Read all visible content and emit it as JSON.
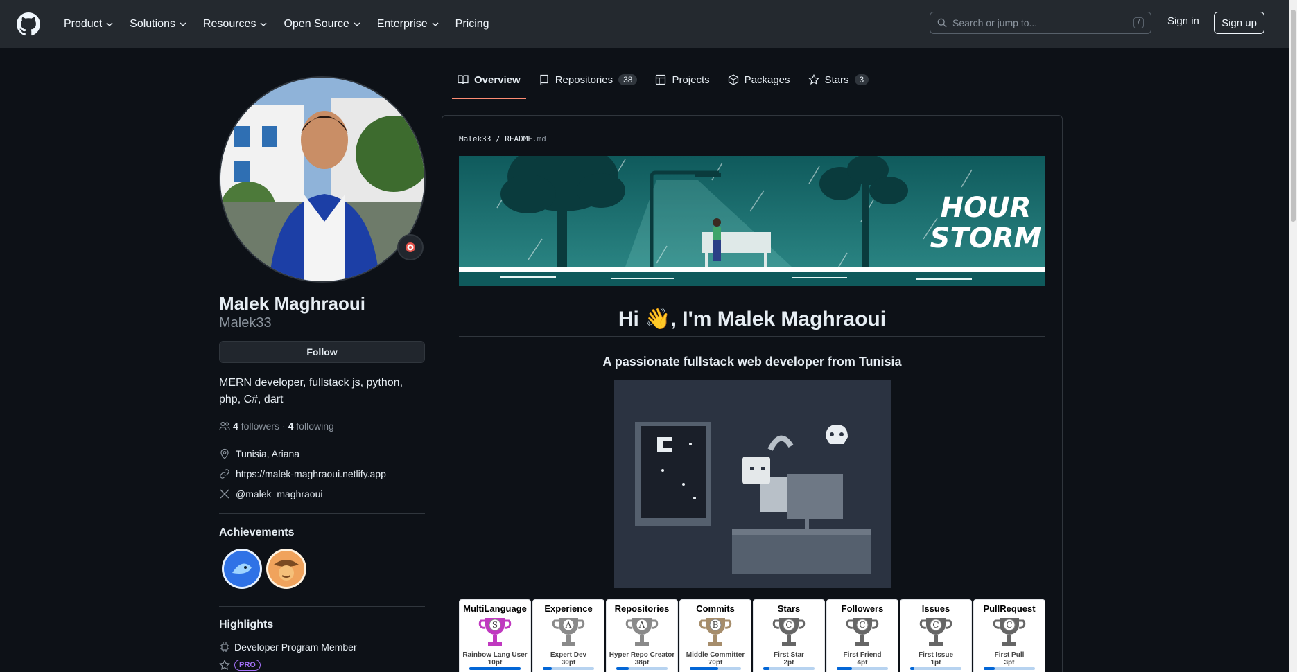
{
  "header": {
    "nav": [
      {
        "label": "Product",
        "has_menu": true
      },
      {
        "label": "Solutions",
        "has_menu": true
      },
      {
        "label": "Resources",
        "has_menu": true
      },
      {
        "label": "Open Source",
        "has_menu": true
      },
      {
        "label": "Enterprise",
        "has_menu": true
      },
      {
        "label": "Pricing",
        "has_menu": false
      }
    ],
    "search_placeholder": "Search or jump to...",
    "search_shortcut": "/",
    "sign_in": "Sign in",
    "sign_up": "Sign up"
  },
  "tabs": [
    {
      "label": "Overview",
      "icon": "book-icon",
      "active": true
    },
    {
      "label": "Repositories",
      "icon": "repo-icon",
      "count": "38"
    },
    {
      "label": "Projects",
      "icon": "table-icon"
    },
    {
      "label": "Packages",
      "icon": "package-icon"
    },
    {
      "label": "Stars",
      "icon": "star-icon",
      "count": "3"
    }
  ],
  "profile": {
    "full_name": "Malek Maghraoui",
    "username": "Malek33",
    "follow_label": "Follow",
    "bio": "MERN developer, fullstack js, python, php, C#, dart",
    "followers_count": "4",
    "followers_label": "followers",
    "separator": "·",
    "following_count": "4",
    "following_label": "following",
    "location": "Tunisia, Ariana",
    "website": "https://malek-maghraoui.netlify.app",
    "twitter": "@malek_maghraoui",
    "achievements_heading": "Achievements",
    "highlights_heading": "Highlights",
    "highlight_item": "Developer Program Member",
    "pro_badge": "PRO"
  },
  "readme": {
    "owner": "Malek33",
    "path_sep": "/",
    "file": "README",
    "file_ext": ".md",
    "banner_text_line1": "HOUR",
    "banner_text_line2": "STORM",
    "heading": "Hi 👋, I'm Malek Maghraoui",
    "tagline": "A passionate fullstack web developer from Tunisia",
    "trophies": [
      {
        "title": "MultiLanguage",
        "rank": "S",
        "name": "Rainbow Lang User",
        "points": "10pt",
        "progress": 1.0,
        "color": "#c039c0"
      },
      {
        "title": "Experience",
        "rank": "A",
        "name": "Expert Dev",
        "points": "30pt",
        "progress": 0.18,
        "color": "#8a8a8a"
      },
      {
        "title": "Repositories",
        "rank": "A",
        "name": "Hyper Repo Creator",
        "points": "38pt",
        "progress": 0.24,
        "color": "#8a8a8a"
      },
      {
        "title": "Commits",
        "rank": "B",
        "name": "Middle Committer",
        "points": "70pt",
        "progress": 0.55,
        "color": "#a68d6b"
      },
      {
        "title": "Stars",
        "rank": "C",
        "name": "First Star",
        "points": "2pt",
        "progress": 0.12,
        "color": "#666666"
      },
      {
        "title": "Followers",
        "rank": "C",
        "name": "First Friend",
        "points": "4pt",
        "progress": 0.3,
        "color": "#666666"
      },
      {
        "title": "Issues",
        "rank": "C",
        "name": "First Issue",
        "points": "1pt",
        "progress": 0.08,
        "color": "#666666"
      },
      {
        "title": "PullRequest",
        "rank": "C",
        "name": "First Pull",
        "points": "3pt",
        "progress": 0.22,
        "color": "#666666"
      }
    ]
  },
  "colors": {
    "accent": "#fd8c73",
    "bg": "#0d1117",
    "header_bg": "#24292f"
  }
}
